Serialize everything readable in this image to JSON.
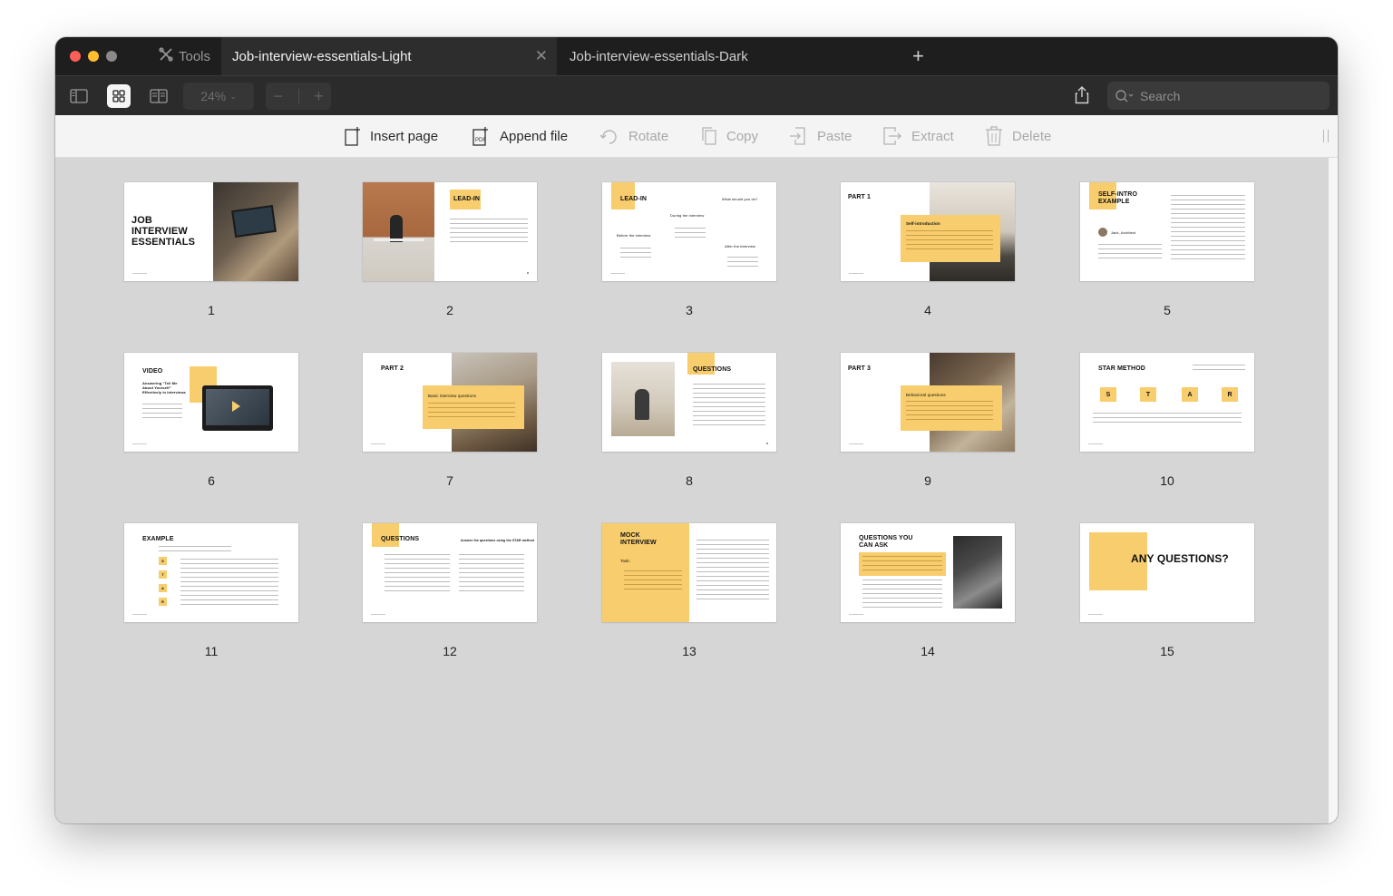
{
  "tabs": {
    "tools_label": "Tools",
    "active_title": "Job-interview-essentials-Light",
    "inactive_title": "Job-interview-essentials-Dark"
  },
  "toolbar": {
    "zoom": "24%",
    "search_placeholder": "Search"
  },
  "page_actions": [
    {
      "label": "Insert page",
      "enabled": true
    },
    {
      "label": "Append file",
      "enabled": true
    },
    {
      "label": "Rotate",
      "enabled": false
    },
    {
      "label": "Copy",
      "enabled": false
    },
    {
      "label": "Paste",
      "enabled": false
    },
    {
      "label": "Extract",
      "enabled": false
    },
    {
      "label": "Delete",
      "enabled": false
    }
  ],
  "pages": [
    {
      "number": "1",
      "title": "JOB\nINTERVIEW\nESSENTIALS"
    },
    {
      "number": "2",
      "title": "LEAD-IN"
    },
    {
      "number": "3",
      "title": "LEAD-IN",
      "subtitle": "What should you do?",
      "labels": [
        "During the interview",
        "Before the interview",
        "After the interview"
      ]
    },
    {
      "number": "4",
      "title": "PART 1",
      "subtitle": "Self-introduction"
    },
    {
      "number": "5",
      "title": "SELF-INTRO\nEXAMPLE",
      "subtitle": "Jack, Architect"
    },
    {
      "number": "6",
      "title": "VIDEO",
      "subtitle": "Answering \"Tell Me\nAbout Yourself\"\nEffectively in Interviews"
    },
    {
      "number": "7",
      "title": "PART 2",
      "subtitle": "Basic interview questions"
    },
    {
      "number": "8",
      "title": "QUESTIONS"
    },
    {
      "number": "9",
      "title": "PART 3",
      "subtitle": "Behavioral questions"
    },
    {
      "number": "10",
      "title": "STAR METHOD",
      "letters": [
        "S",
        "T",
        "A",
        "R"
      ]
    },
    {
      "number": "11",
      "title": "EXAMPLE",
      "letters": [
        "S",
        "T",
        "A",
        "R"
      ]
    },
    {
      "number": "12",
      "title": "QUESTIONS",
      "subtitle": "Answer the questions using the STAR method"
    },
    {
      "number": "13",
      "title": "MOCK\nINTERVIEW",
      "subtitle": "Task:"
    },
    {
      "number": "14",
      "title": "QUESTIONS YOU\nCAN ASK"
    },
    {
      "number": "15",
      "title": "ANY QUESTIONS?"
    }
  ]
}
